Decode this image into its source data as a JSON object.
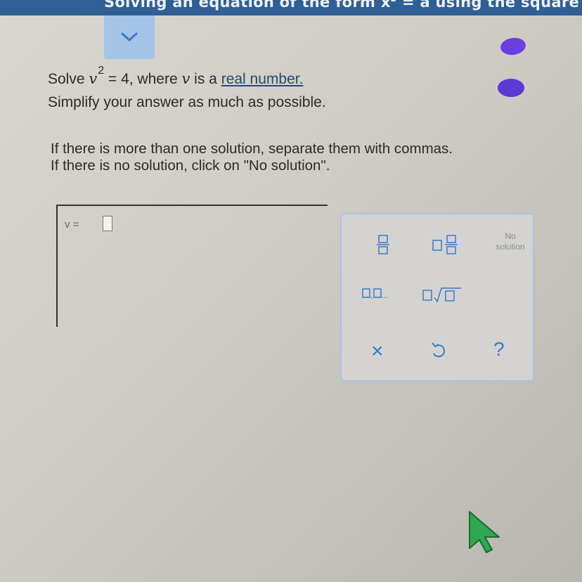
{
  "header": {
    "title_main": "Solving an equation of the form x",
    "title_exp": "2",
    "title_tail": " = a using the square root property"
  },
  "problem": {
    "solve_word": "Solve",
    "variable": "v",
    "exponent": "2",
    "equals_part": " = 4, where ",
    "where_var": "v",
    "is_a": " is a ",
    "link_text": "real number.",
    "simplify": "Simplify your answer as much as possible."
  },
  "instructions": {
    "line1": "If there is more than one solution, separate them with commas.",
    "line2": "If there is no solution, click on \"No solution\"."
  },
  "answer": {
    "label": "v =",
    "value": ""
  },
  "keypad": {
    "no_solution_line1": "No",
    "no_solution_line2": "solution",
    "list_ellipsis": "...",
    "clear_symbol": "×",
    "help_symbol": "?"
  },
  "colors": {
    "header_bg": "#2f5f95",
    "tab_bg": "#a3c4e6",
    "dot": "#6c3fe0",
    "key_blue": "#3a7acb",
    "cursor": "#2fa84f"
  },
  "icons": [
    "chevron-down-icon",
    "fraction-icon",
    "mixed-number-icon",
    "list-icon",
    "nth-root-icon",
    "clear-icon",
    "undo-icon",
    "help-icon",
    "mouse-pointer-icon"
  ]
}
